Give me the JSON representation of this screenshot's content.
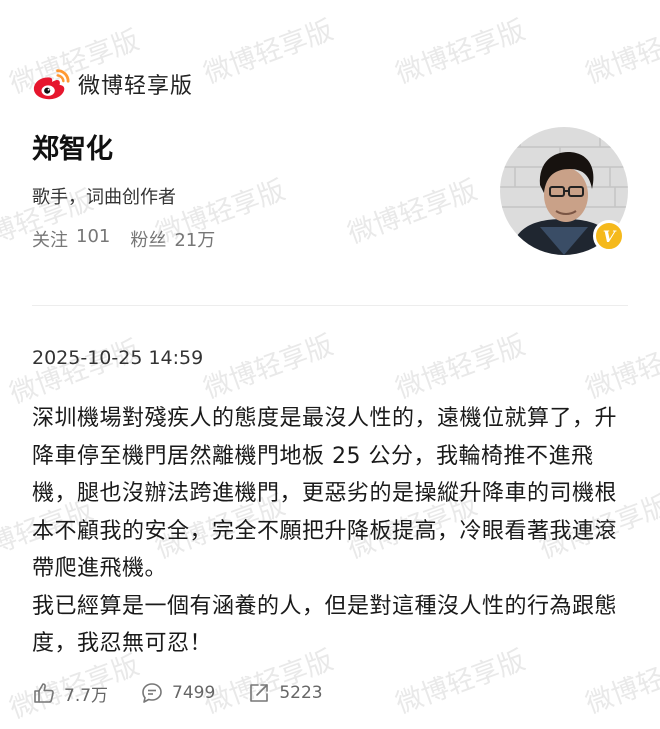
{
  "app": {
    "name": "微博轻享版"
  },
  "watermark": "微博轻享版",
  "profile": {
    "name": "郑智化",
    "bio": "歌手，词曲创作者",
    "following_label": "关注",
    "following_count": "101",
    "followers_label": "粉丝",
    "followers_count": "21万",
    "verified_badge": "V"
  },
  "post": {
    "time": "2025-10-25 14:59",
    "paragraphs": [
      "深圳機場對殘疾人的態度是最沒人性的，遠機位就算了，升降車停至機門居然離機門地板 25 公分，我輪椅推不進飛機，腿也沒辦法跨進機門，更惡劣的是操縱升降車的司機根本不顧我的安全，完全不願把升降板提高，冷眼看著我連滾帶爬進飛機。",
      "我已經算是一個有涵養的人，但是對這種沒人性的行為跟態度，我忍無可忍！"
    ]
  },
  "actions": {
    "likes": "7.7万",
    "comments": "7499",
    "reposts": "5223"
  },
  "colors": {
    "brand_red": "#e6162d",
    "brand_orange": "#ff9933",
    "verified": "#f5b91c"
  }
}
